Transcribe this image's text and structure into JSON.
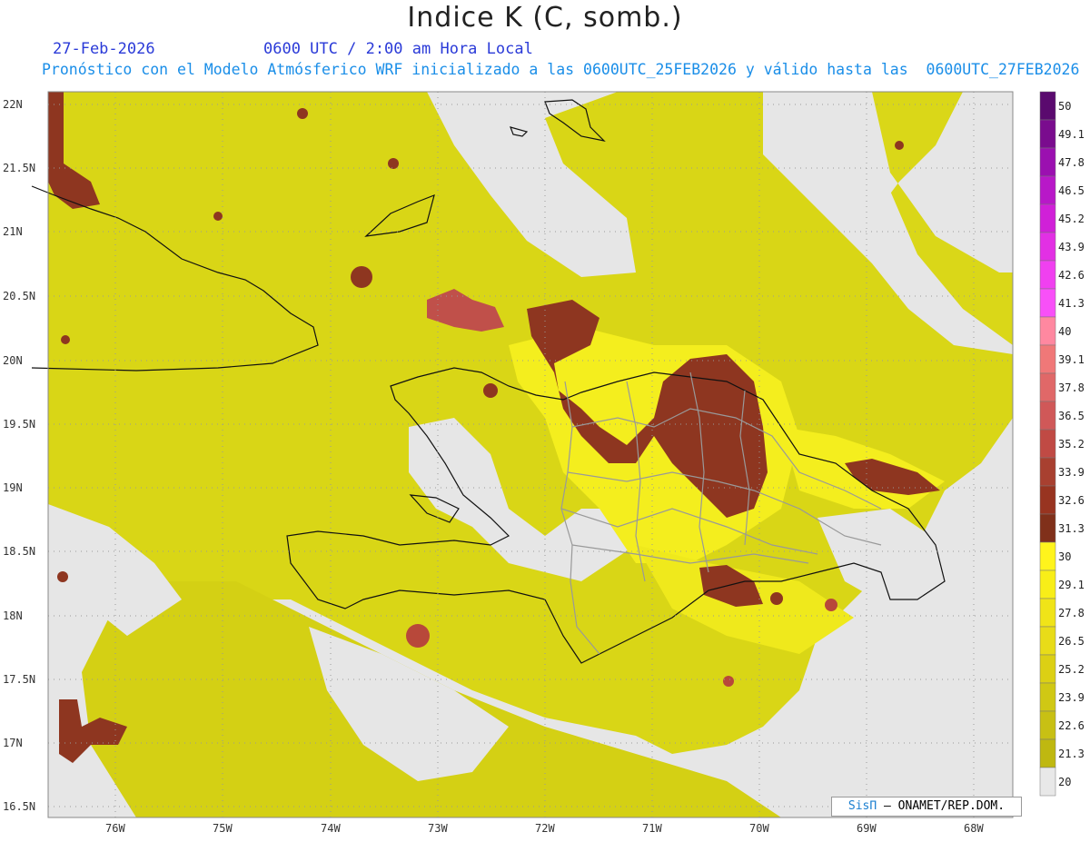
{
  "title": "Indice K (C, somb.)",
  "date": "27-Feb-2026",
  "time": "0600 UTC / 2:00 am Hora Local",
  "description": "Pronóstico con el Modelo Atmósferico WRF inicializado a las 0600UTC_25FEB2026 y válido hasta las  0600UTC_27FEB2026",
  "credit": {
    "brand": "SisΠ",
    "text": "– ONAMET/REP.DOM."
  },
  "lat_labels": [
    "22N",
    "21.5N",
    "21N",
    "20.5N",
    "20N",
    "19.5N",
    "19N",
    "18.5N",
    "18N",
    "17.5N",
    "17N",
    "16.5N"
  ],
  "lon_labels": [
    "76W",
    "75W",
    "74W",
    "73W",
    "72W",
    "71W",
    "70W",
    "69W",
    "68W"
  ],
  "colorbar": {
    "labels": [
      "50",
      "49.1",
      "47.8",
      "46.5",
      "45.2",
      "43.9",
      "42.6",
      "41.3",
      "40",
      "39.1",
      "37.8",
      "36.5",
      "35.2",
      "33.9",
      "32.6",
      "31.3",
      "30",
      "29.1",
      "27.8",
      "26.5",
      "25.2",
      "23.9",
      "22.6",
      "21.3",
      "20"
    ],
    "colors": [
      "#5a0a6e",
      "#7a0c8e",
      "#9b10b0",
      "#b818c8",
      "#d020d8",
      "#e230e4",
      "#f040f0",
      "#f850f8",
      "#ff88a0",
      "#f07878",
      "#e06868",
      "#d05858",
      "#c04a44",
      "#a84030",
      "#983420",
      "#80301a",
      "#fff41c",
      "#f8ee18",
      "#f0e418",
      "#e8dc18",
      "#dcd014",
      "#d0c814",
      "#c8c014",
      "#bfb810",
      "#e8e8e8"
    ]
  },
  "colors": {
    "background_sea": "#e6e6e6",
    "field_main": "#e0de18",
    "field_high": "#f6f020",
    "field_extreme": "#8e3620"
  }
}
